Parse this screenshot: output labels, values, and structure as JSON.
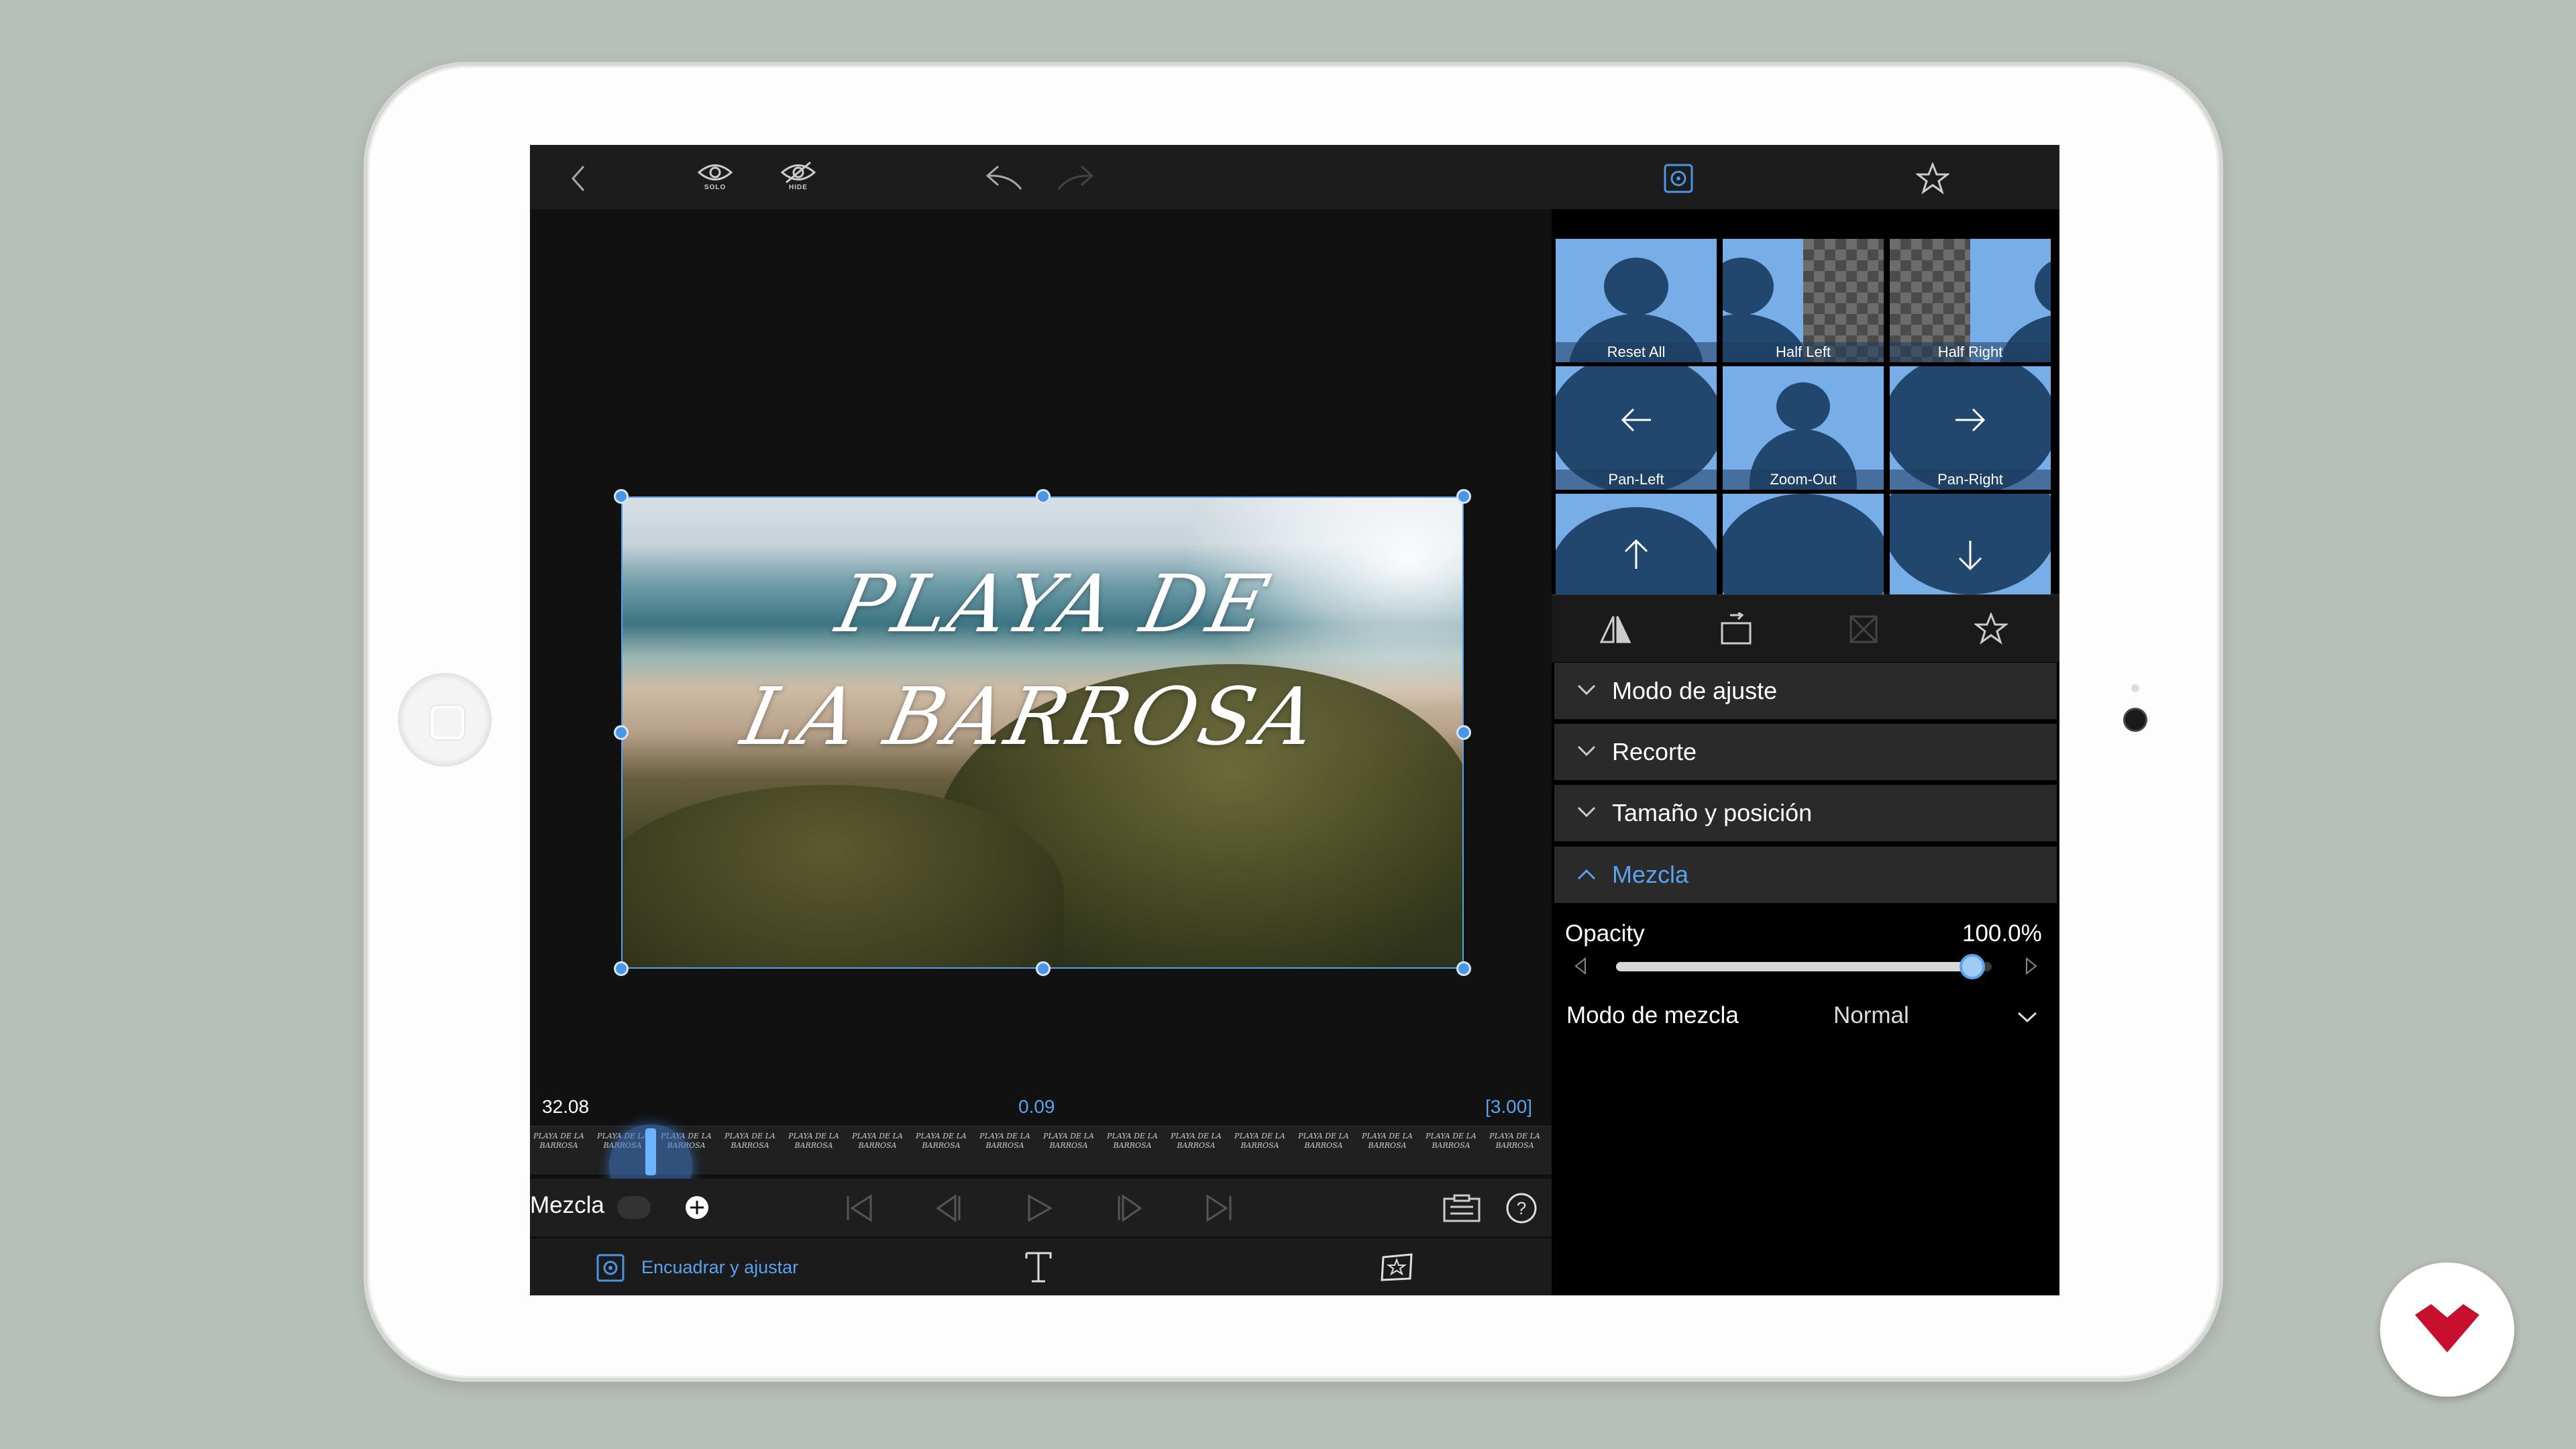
{
  "toolbar": {
    "solo_label": "SOLO",
    "hide_label": "HIDE"
  },
  "preview": {
    "title_line1": "PLAYA DE",
    "title_line2": "LA BARROSA",
    "time_left": "32.08",
    "time_center": "0.09",
    "time_right": "[3.00]",
    "thumb_text": "PLAYA DE LA BARROSA"
  },
  "controls": {
    "mode_label": "Mezcla"
  },
  "bottom": {
    "fit_label": "Encuadrar y ajustar"
  },
  "presets": [
    {
      "label": "Reset All"
    },
    {
      "label": "Half Left"
    },
    {
      "label": "Half Right"
    },
    {
      "label": "Pan-Left"
    },
    {
      "label": "Zoom-Out"
    },
    {
      "label": "Pan-Right"
    }
  ],
  "sections": [
    {
      "label": "Modo de ajuste"
    },
    {
      "label": "Recorte"
    },
    {
      "label": "Tamaño y posición"
    },
    {
      "label": "Mezcla"
    }
  ],
  "blend": {
    "opacity_label": "Opacity",
    "opacity_value": "100.0%",
    "opacity_fraction": 1.0,
    "mode_label": "Modo de mezcla",
    "mode_value": "Normal"
  },
  "colors": {
    "accent": "#4a95e6",
    "panel_bg": "#000000",
    "preset_bg": "#78aee8",
    "brand_red": "#c8102e"
  },
  "icons": [
    "back-chevron-icon",
    "solo-eye-icon",
    "hide-eye-icon",
    "undo-icon",
    "redo-icon",
    "transform-icon",
    "favorite-star-icon"
  ]
}
